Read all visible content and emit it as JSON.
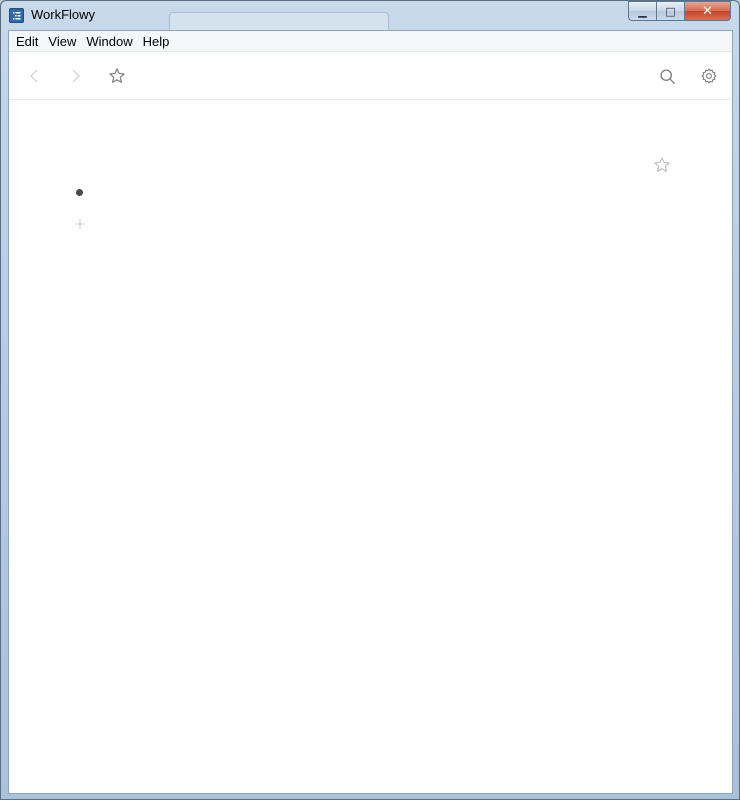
{
  "window": {
    "title": "WorkFlowy",
    "minimize_glyph": "▁",
    "maximize_glyph": "□",
    "close_glyph": "✕"
  },
  "menu": {
    "items": [
      "Edit",
      "View",
      "Window",
      "Help"
    ]
  },
  "toolbar": {
    "icons": [
      "back-arrow-icon",
      "forward-arrow-icon",
      "star-icon",
      "search-icon",
      "gear-icon"
    ]
  },
  "content": {
    "bullet_text": "",
    "icons": [
      "star-icon",
      "bullet-dot-icon",
      "plus-icon"
    ]
  },
  "colors": {
    "icon_gray": "#8a8a8a",
    "icon_light": "#cfcfcf",
    "bullet": "#4a4a4a"
  }
}
